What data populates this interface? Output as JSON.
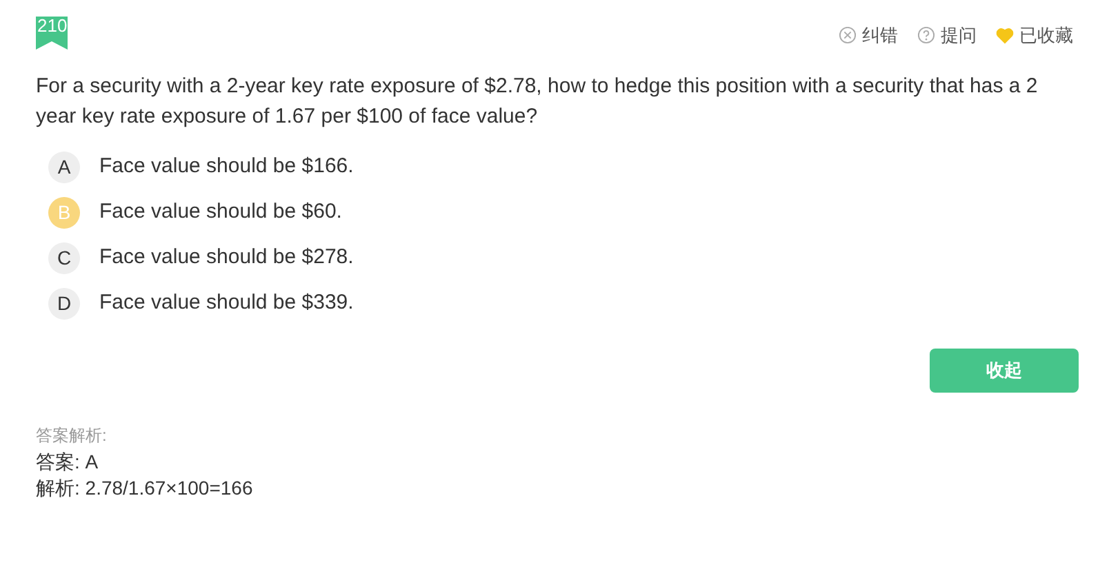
{
  "question_number": "210",
  "actions": [
    {
      "kind": "report",
      "label": "纠错"
    },
    {
      "kind": "ask",
      "label": "提问"
    },
    {
      "kind": "favorite",
      "label": "已收藏",
      "on": true
    }
  ],
  "question": "For a security with a 2-year key rate exposure of $2.78, how to hedge this position with a security that has a 2 year key rate exposure of 1.67 per $100 of face value?",
  "options": [
    {
      "letter": "A",
      "text": "Face value should be $166.",
      "selected": false
    },
    {
      "letter": "B",
      "text": "Face value should be $60.",
      "selected": true
    },
    {
      "letter": "C",
      "text": "Face value should be $278.",
      "selected": false
    },
    {
      "letter": "D",
      "text": "Face value should be $339.",
      "selected": false
    }
  ],
  "collapse_button": "收起",
  "analysis": {
    "heading": "答案解析:",
    "answer": "答案: A",
    "explanation": "解析: 2.78/1.67×100=166"
  }
}
